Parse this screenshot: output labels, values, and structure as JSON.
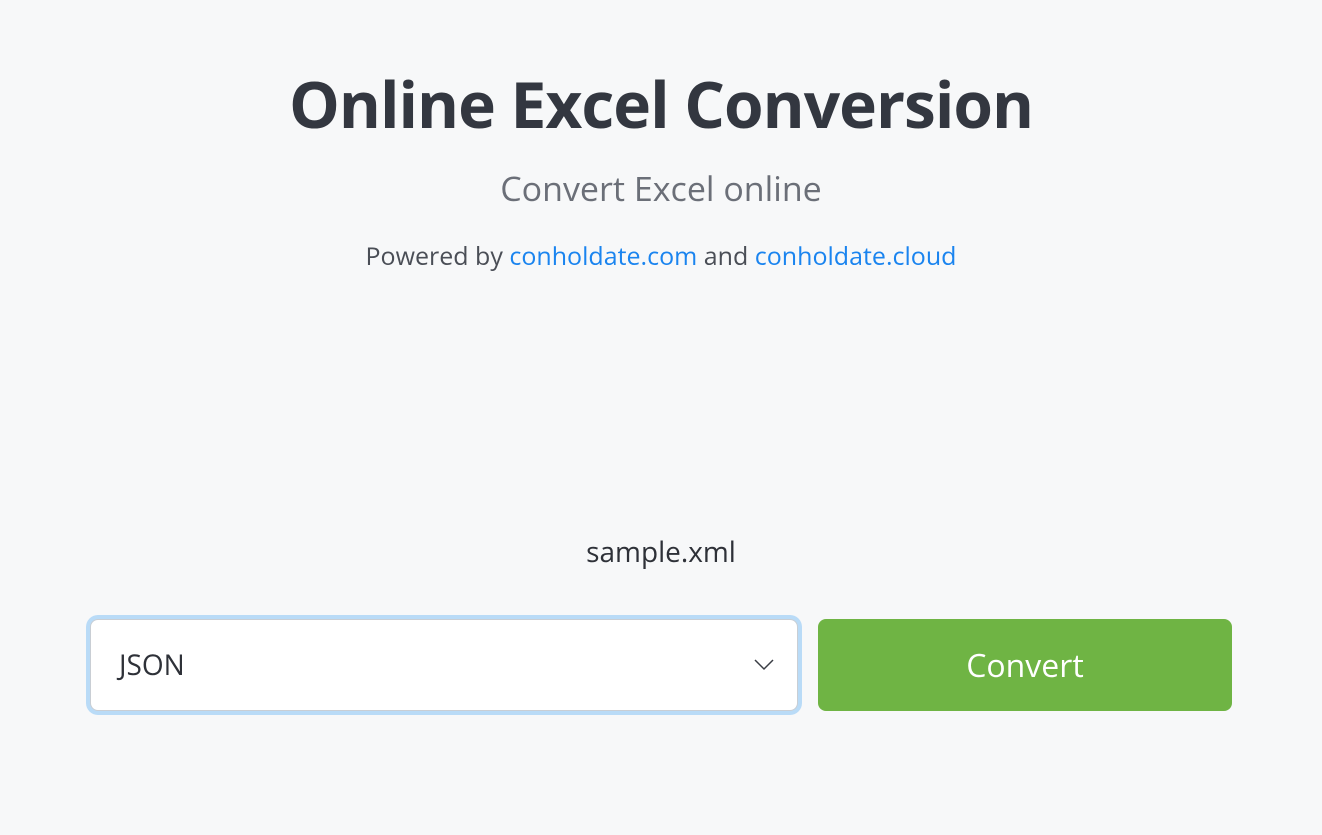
{
  "header": {
    "title": "Online Excel Conversion",
    "subtitle": "Convert Excel online",
    "powered_by_prefix": "Powered by ",
    "link1_text": "conholdate.com",
    "and_text": " and ",
    "link2_text": "conholdate.cloud"
  },
  "file": {
    "name": "sample.xml"
  },
  "controls": {
    "format_selected": "JSON",
    "convert_label": "Convert"
  }
}
